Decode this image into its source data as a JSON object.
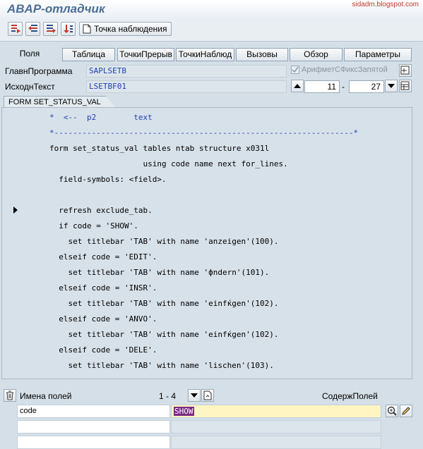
{
  "app": {
    "title": "ABAP-отладчик",
    "watermark": "sidadm.blogspot.com"
  },
  "toolbar": {
    "buttons": [
      "step-into-icon",
      "step-over-icon",
      "return-icon",
      "continue-icon"
    ],
    "watch_label": "Точка наблюдения"
  },
  "tabs": [
    "Поля",
    "Таблица",
    "ТочкиПрерыв",
    "ТочкиНаблюд",
    "Вызовы",
    "Обзор",
    "Параметры"
  ],
  "fields": {
    "main_program_label": "ГлавнПрограмма",
    "main_program_value": "SAPLSETB",
    "checkbox_label": "АрифметСФиксЗапятой",
    "source_label": "ИсходнТекст",
    "source_value": "LSETBF01",
    "line_from": "11",
    "line_sep": "-",
    "line_to": "27"
  },
  "code": {
    "title": "FORM SET_STATUS_VAL",
    "lines": [
      "*  <--  p2        text",
      "*----------------------------------------------------------------*",
      "form set_status_val tables ntab structure x031l",
      "                    using code name next for_lines.",
      "  field-symbols: <field>.",
      "",
      "  refresh exclude_tab.",
      "  if code = 'SHOW'.",
      "    set titlebar 'TAB' with name 'anzeigen'(100).",
      "  elseif code = 'EDIT'.",
      "    set titlebar 'TAB' with name 'фndern'(101).",
      "  elseif code = 'INSR'.",
      "    set titlebar 'TAB' with name 'einfќgen'(102).",
      "  elseif code = 'ANVO'.",
      "    set titlebar 'TAB' with name 'einfќgen'(102).",
      "  elseif code = 'DELE'.",
      "    set titlebar 'TAB' with name 'lischen'(103)."
    ]
  },
  "table": {
    "col_names": "Имена полей",
    "range": "1 - 4",
    "col_values": "СодержПолей",
    "rows": [
      {
        "name": "code",
        "value": "SHOW"
      },
      {
        "name": "",
        "value": ""
      },
      {
        "name": "",
        "value": ""
      }
    ]
  }
}
